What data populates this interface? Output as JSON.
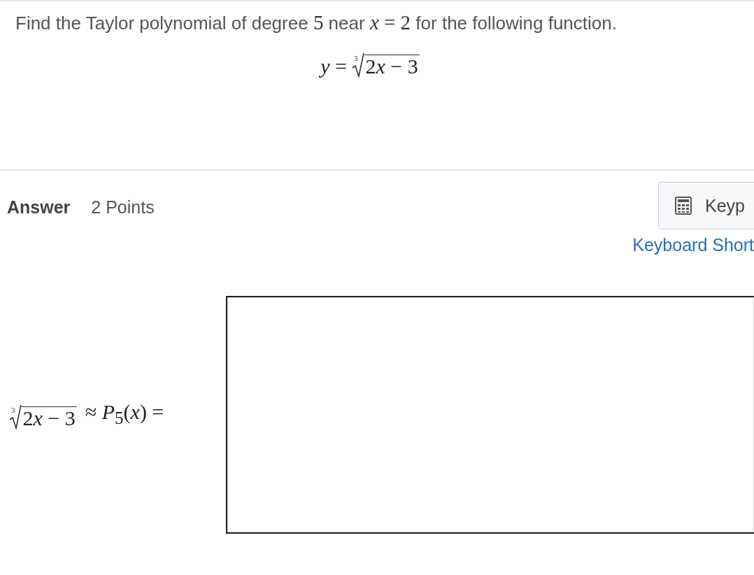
{
  "question": {
    "prompt": [
      {
        "kind": "text",
        "text": "Find the Taylor polynomial of degree "
      },
      {
        "kind": "math",
        "text": "5"
      },
      {
        "kind": "text",
        "text": " near "
      },
      {
        "kind": "math",
        "text": "*x* = 2"
      },
      {
        "kind": "text",
        "text": " for the following function."
      }
    ],
    "formula": {
      "lhs": "*y* =",
      "radical": {
        "index": "3",
        "radicand": [
          {
            "kind": "plain",
            "text": "2"
          },
          {
            "kind": "variable",
            "text": "x"
          },
          {
            "kind": "plain",
            "text": " − 3"
          }
        ]
      }
    }
  },
  "answer": {
    "label": "Answer",
    "points": "2 Points",
    "keypad_button": "Keyp",
    "shortcuts_link": "Keyboard Short",
    "formula": {
      "radical": {
        "index": "3",
        "radicand": [
          {
            "kind": "plain",
            "text": "2"
          },
          {
            "kind": "variable",
            "text": "x"
          },
          {
            "kind": "plain",
            "text": " − 3"
          }
        ]
      },
      "rhs": "≈ *P*$_{5}$(*x*) ="
    }
  }
}
